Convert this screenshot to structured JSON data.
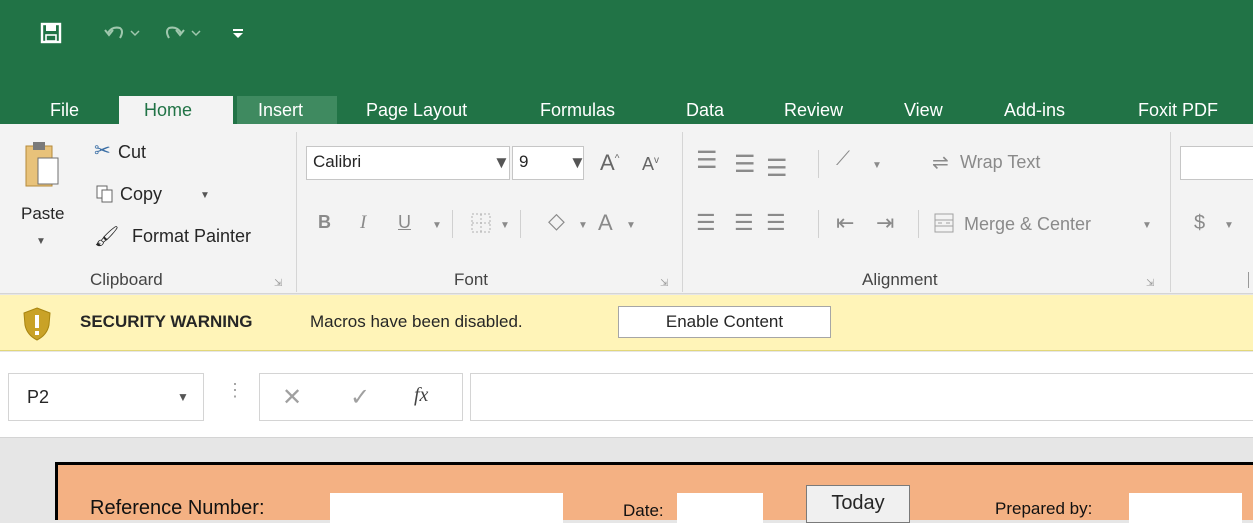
{
  "quick_access": {
    "save_icon": "floppy-disk-icon",
    "undo_icon": "undo-icon",
    "redo_icon": "redo-icon",
    "customize_icon": "customize-qat-icon"
  },
  "tabs": [
    "File",
    "Home",
    "Insert",
    "Page Layout",
    "Formulas",
    "Data",
    "Review",
    "View",
    "Add-ins",
    "Foxit PDF"
  ],
  "active_tab": "Home",
  "ribbon": {
    "clipboard": {
      "paste": "Paste",
      "cut": "Cut",
      "copy": "Copy",
      "format_painter": "Format Painter",
      "group_label": "Clipboard"
    },
    "font": {
      "font_name": "Calibri",
      "font_size": "9",
      "bold": "B",
      "italic": "I",
      "underline": "U",
      "font_color_letter": "A",
      "increase_size": "A",
      "decrease_size": "A",
      "group_label": "Font"
    },
    "alignment": {
      "wrap_text": "Wrap Text",
      "merge_center": "Merge & Center",
      "group_label": "Alignment"
    },
    "number": {
      "currency": "$"
    }
  },
  "security_bar": {
    "title": "SECURITY WARNING",
    "message": "Macros have been disabled.",
    "button": "Enable Content"
  },
  "formula_bar": {
    "name_box": "P2",
    "fx_label": "fx",
    "formula": ""
  },
  "sheet": {
    "reference_label": "Reference Number:",
    "date_label": "Date:",
    "today_button": "Today",
    "prepared_label": "Prepared by:"
  },
  "colors": {
    "excel_green": "#217346",
    "security_bar": "#fff4b8",
    "form_background": "#f4b183"
  }
}
